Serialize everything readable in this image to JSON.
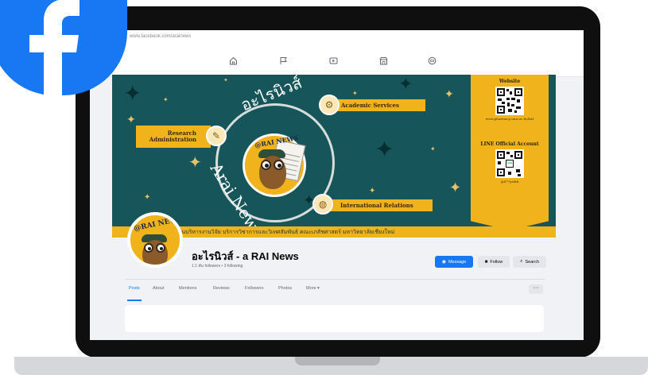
{
  "browser": {
    "url": "www.facebook.com/arainews"
  },
  "nav": {
    "icons": [
      "home-icon",
      "flag-icon",
      "video-icon",
      "marketplace-icon",
      "gaming-icon"
    ]
  },
  "cover": {
    "ring_text_top": "อะไรนิวส์",
    "ring_text_left": "Arai News",
    "news_badge": "@RAI NEWS",
    "tags": {
      "academic": "Academic Services",
      "research": "Research Administration",
      "international": "International Relations"
    },
    "qr": {
      "website_title": "Website",
      "website_url": "www.pharmacy.cmu.ac.th/RAI",
      "line_title": "LINE Official Account",
      "line_id": "@877yrdrb",
      "line_label": "LINE"
    },
    "strip_text": "งานบริหารงานวิจัย บริการวิชาการและวิเทศสัมพันธ์   คณะเภสัชศาสตร์ มหาวิทยาลัยเชียงใหม่"
  },
  "profile": {
    "badge": "@RAI NEWS",
    "name": "อะไรนิวส์ - a RAI News",
    "stats": "1.1 พัน followers • 3 following"
  },
  "actions": {
    "message": "Message",
    "follow": "Follow",
    "search": "Search"
  },
  "tabs": [
    "Posts",
    "About",
    "Mentions",
    "Reviews",
    "Followers",
    "Photos",
    "More ▾"
  ],
  "more_button": "···",
  "colors": {
    "facebook_blue": "#1877f2",
    "cover_teal": "#16565a",
    "accent_gold": "#f1b31b"
  }
}
